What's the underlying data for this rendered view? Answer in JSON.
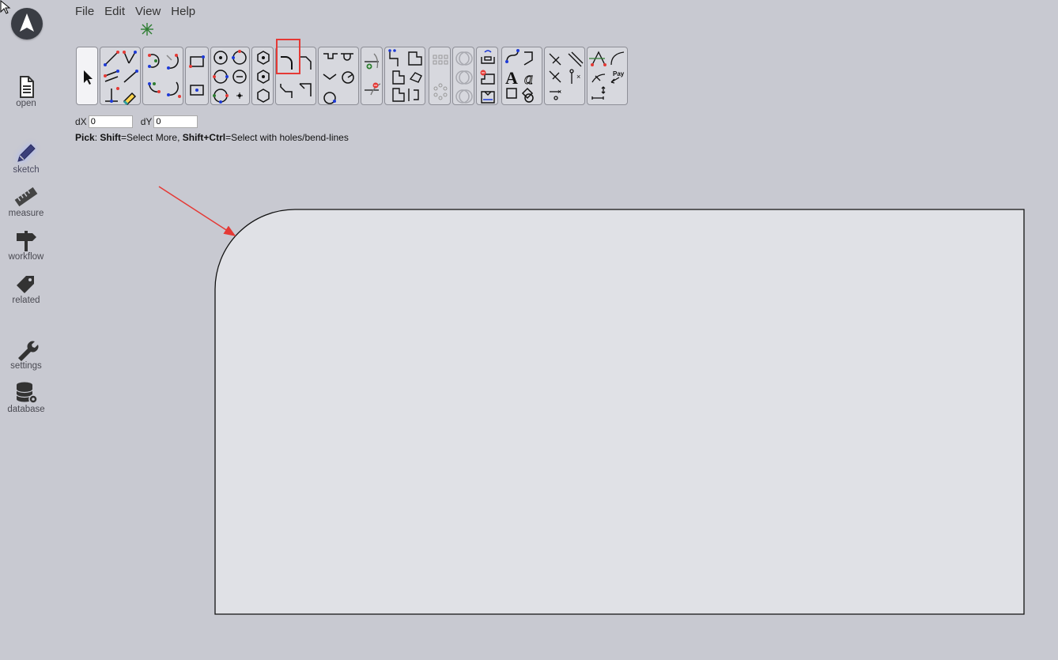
{
  "sidebar": {
    "items": [
      {
        "label": "open",
        "icon": "open-file-icon"
      },
      {
        "label": "sketch",
        "icon": "pencil-icon"
      },
      {
        "label": "measure",
        "icon": "ruler-icon"
      },
      {
        "label": "workflow",
        "icon": "signpost-icon"
      },
      {
        "label": "related",
        "icon": "tags-icon"
      },
      {
        "label": "settings",
        "icon": "wrench-icon"
      },
      {
        "label": "database",
        "icon": "database-icon"
      }
    ]
  },
  "menu": {
    "file": "File",
    "edit": "Edit",
    "view": "View",
    "help": "Help"
  },
  "coords": {
    "dx_label": "dX",
    "dx_value": "0",
    "dy_label": "dY",
    "dy_value": "0"
  },
  "hint": {
    "pick": "Pick",
    "sep1": ": ",
    "shift": "Shift",
    "shift_desc": "=Select More, ",
    "shift_ctrl": "Shift+Ctrl",
    "shift_ctrl_desc": "=Select with holes/bend-lines"
  },
  "toolbar_text": {
    "text_a": "A",
    "pay": "Pay"
  },
  "colors": {
    "background": "#c8c9d1",
    "shape_fill": "#e0e1e6",
    "annotation": "#e53935",
    "sketch_active_glow": "#a8b8ff"
  }
}
